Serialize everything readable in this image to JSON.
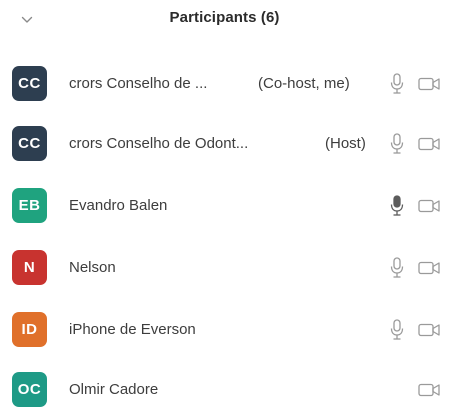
{
  "header": {
    "title": "Participants (6)"
  },
  "colors": {
    "avatar_cc": "#2d3e50",
    "avatar_eb": "#1fa37f",
    "avatar_n": "#c8332f",
    "avatar_id": "#e0702a",
    "avatar_oc": "#1e9a86"
  },
  "participants": [
    {
      "initials": "CC",
      "name": "crors Conselho de ...",
      "role": "(Co-host, me)",
      "avatar_color": "#2d3e50",
      "mic_icon": "mic-muted-icon",
      "cam_icon": "video-camera-icon"
    },
    {
      "initials": "CC",
      "name": "crors Conselho de Odont...",
      "role": "(Host)",
      "avatar_color": "#2d3e50",
      "mic_icon": "mic-muted-icon",
      "cam_icon": "video-camera-icon"
    },
    {
      "initials": "EB",
      "name": "Evandro Balen",
      "role": "",
      "avatar_color": "#1fa37f",
      "mic_icon": "mic-active-icon",
      "cam_icon": "video-camera-icon"
    },
    {
      "initials": "N",
      "name": "Nelson",
      "role": "",
      "avatar_color": "#c8332f",
      "mic_icon": "mic-muted-icon",
      "cam_icon": "video-camera-icon"
    },
    {
      "initials": "ID",
      "name": "iPhone de Everson",
      "role": "",
      "avatar_color": "#e0702a",
      "mic_icon": "mic-muted-icon",
      "cam_icon": "video-camera-icon"
    },
    {
      "initials": "OC",
      "name": "Olmir Cadore",
      "role": "",
      "avatar_color": "#1e9a86",
      "mic_icon": "",
      "cam_icon": "video-camera-icon"
    }
  ]
}
